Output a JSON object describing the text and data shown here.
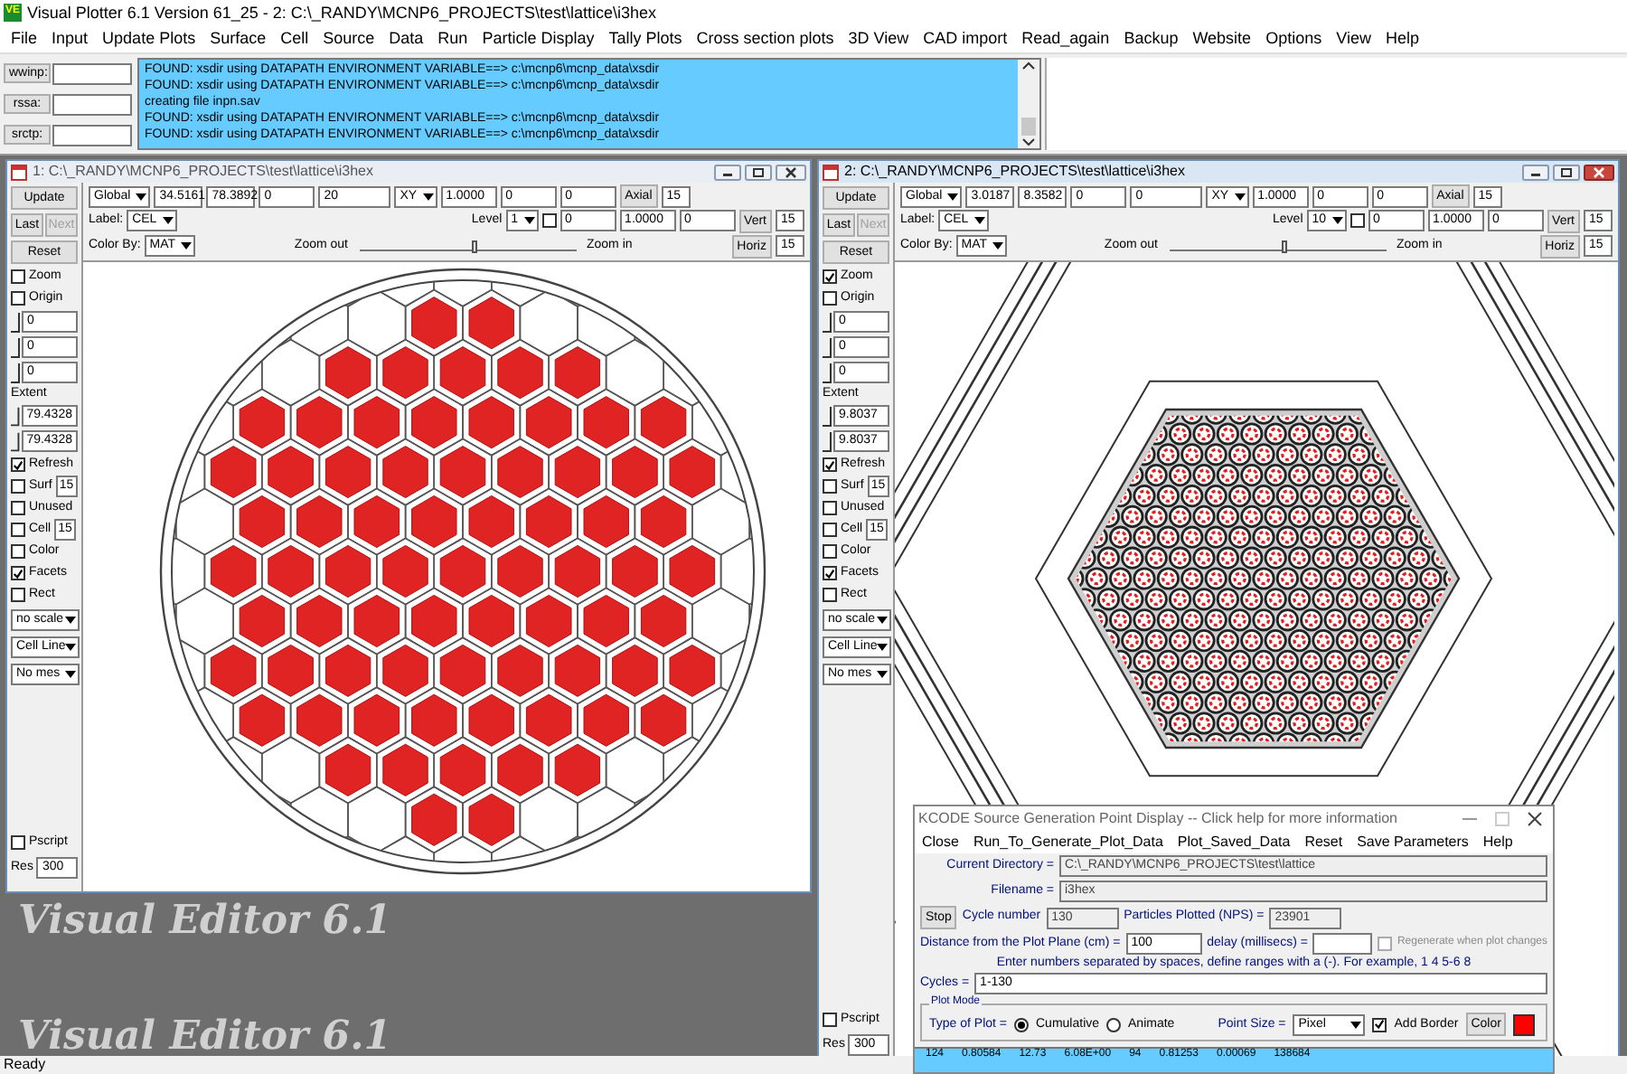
{
  "window": {
    "icon_text": "VE",
    "title": "Visual Plotter 6.1 Version 61_25  - 2:  C:\\_RANDY\\MCNP6_PROJECTS\\test\\lattice\\i3hex"
  },
  "menu": [
    "File",
    "Input",
    "Update Plots",
    "Surface",
    "Cell",
    "Source",
    "Data",
    "Run",
    "Particle Display",
    "Tally Plots",
    "Cross section plots",
    "3D View",
    "CAD import",
    "Read_again",
    "Backup",
    "Website",
    "Options",
    "View",
    "Help"
  ],
  "top_fields": [
    {
      "label": "wwinp:"
    },
    {
      "label": "rssa:"
    },
    {
      "label": "srctp:"
    }
  ],
  "messages": [
    "FOUND: xsdir  using DATAPATH ENVIRONMENT VARIABLE==>  c:\\mcnp6\\mcnp_data\\xsdir",
    "FOUND: xsdir  using DATAPATH ENVIRONMENT VARIABLE==>  c:\\mcnp6\\mcnp_data\\xsdir",
    "creating file inpn.sav",
    "FOUND: xsdir  using DATAPATH ENVIRONMENT VARIABLE==>  c:\\mcnp6\\mcnp_data\\xsdir",
    "FOUND: xsdir  using DATAPATH ENVIRONMENT VARIABLE==>  c:\\mcnp6\\mcnp_data\\xsdir"
  ],
  "background_text": [
    "Visual Editor 6.1",
    "Visual Editor 6.1"
  ],
  "plot_windows": [
    {
      "title": "1:  C:\\_RANDY\\MCNP6_PROJECTS\\test\\lattice\\i3hex",
      "active": false,
      "kind": "core",
      "toolbar": {
        "origin": "Global",
        "row1": [
          "34.5161",
          "78.3892",
          "0",
          "20"
        ],
        "plane": "XY",
        "row1b": [
          "1.0000",
          "0",
          "0"
        ],
        "label_caption": "Label:",
        "label": "CEL",
        "level_caption": "Level",
        "level_value": "1",
        "level_checked": false,
        "row2": [
          "0",
          "1.0000",
          "0"
        ],
        "color_by_caption": "Color By:",
        "color_by": "MAT",
        "zoom_out": "Zoom out",
        "zoom_in": "Zoom in",
        "zoom": {
          "level": 0.52
        },
        "axes": [
          {
            "label": "Axial",
            "value": "15"
          },
          {
            "label": "Vert",
            "value": "15"
          },
          {
            "label": "Horiz",
            "value": "15"
          }
        ]
      },
      "sidebar": [
        {
          "kind": "button",
          "label": "Update"
        },
        {
          "kind": "pair",
          "buttons": [
            {
              "label": "Last",
              "disabled": false
            },
            {
              "label": "Next",
              "disabled": true
            }
          ]
        },
        {
          "kind": "button",
          "label": "Reset"
        },
        {
          "kind": "check",
          "label": "Zoom",
          "checked": false
        },
        {
          "kind": "check",
          "label": "Origin",
          "checked": false
        },
        {
          "kind": "slider",
          "value": "0"
        },
        {
          "kind": "slider",
          "value": "0"
        },
        {
          "kind": "slider",
          "value": "0"
        },
        {
          "kind": "caption",
          "label": "Extent"
        },
        {
          "kind": "slider",
          "value": "79.4328"
        },
        {
          "kind": "slider",
          "value": "79.4328"
        },
        {
          "kind": "check",
          "label": "Refresh",
          "checked": true
        },
        {
          "kind": "check",
          "label": "Surf",
          "checked": false,
          "value": "15"
        },
        {
          "kind": "check",
          "label": "Unused",
          "checked": false
        },
        {
          "kind": "check",
          "label": "Cell",
          "checked": false,
          "value": "15"
        },
        {
          "kind": "check",
          "label": "Color",
          "checked": false
        },
        {
          "kind": "check",
          "label": "Facets",
          "checked": true
        },
        {
          "kind": "check",
          "label": "Rect",
          "checked": false
        },
        {
          "kind": "select",
          "value": "no scale"
        },
        {
          "kind": "select",
          "value": "Cell Line"
        },
        {
          "kind": "select",
          "value": "No mes"
        }
      ],
      "sidebar_bottom": [
        {
          "kind": "check",
          "label": "Pscript",
          "checked": false
        },
        {
          "kind": "field",
          "label": "Res",
          "value": "300"
        }
      ]
    },
    {
      "title": "2:  C:\\_RANDY\\MCNP6_PROJECTS\\test\\lattice\\i3hex",
      "active": true,
      "kind": "assembly",
      "toolbar": {
        "origin": "Global",
        "row1": [
          "3.0187",
          "8.3582",
          "0",
          "0"
        ],
        "plane": "XY",
        "row1b": [
          "1.0000",
          "0",
          "0"
        ],
        "label_caption": "Label:",
        "label": "CEL",
        "level_caption": "Level",
        "level_value": "10",
        "level_checked": false,
        "row2": [
          "0",
          "1.0000",
          "0"
        ],
        "color_by_caption": "Color By:",
        "color_by": "MAT",
        "zoom_out": "Zoom out",
        "zoom_in": "Zoom in",
        "zoom": {
          "level": 0.52
        },
        "axes": [
          {
            "label": "Axial",
            "value": "15"
          },
          {
            "label": "Vert",
            "value": "15"
          },
          {
            "label": "Horiz",
            "value": "15"
          }
        ]
      },
      "sidebar": [
        {
          "kind": "button",
          "label": "Update"
        },
        {
          "kind": "pair",
          "buttons": [
            {
              "label": "Last",
              "disabled": false
            },
            {
              "label": "Next",
              "disabled": true
            }
          ]
        },
        {
          "kind": "button",
          "label": "Reset"
        },
        {
          "kind": "check",
          "label": "Zoom",
          "checked": true
        },
        {
          "kind": "check",
          "label": "Origin",
          "checked": false
        },
        {
          "kind": "slider",
          "value": "0"
        },
        {
          "kind": "slider",
          "value": "0"
        },
        {
          "kind": "slider",
          "value": "0"
        },
        {
          "kind": "caption",
          "label": "Extent"
        },
        {
          "kind": "slider",
          "value": "9.8037"
        },
        {
          "kind": "slider",
          "value": "9.8037"
        },
        {
          "kind": "check",
          "label": "Refresh",
          "checked": true
        },
        {
          "kind": "check",
          "label": "Surf",
          "checked": false,
          "value": "15"
        },
        {
          "kind": "check",
          "label": "Unused",
          "checked": false
        },
        {
          "kind": "check",
          "label": "Cell",
          "checked": false,
          "value": "15"
        },
        {
          "kind": "check",
          "label": "Color",
          "checked": false
        },
        {
          "kind": "check",
          "label": "Facets",
          "checked": true
        },
        {
          "kind": "check",
          "label": "Rect",
          "checked": false
        },
        {
          "kind": "select",
          "value": "no scale"
        },
        {
          "kind": "select",
          "value": "Cell Line"
        },
        {
          "kind": "select",
          "value": "No mes"
        }
      ],
      "sidebar_bottom": [
        {
          "kind": "check",
          "label": "Pscript",
          "checked": false
        },
        {
          "kind": "field",
          "label": "Res",
          "value": "300"
        }
      ]
    }
  ],
  "kcode_dialog": {
    "title": "KCODE Source Generation Point Display -- Click help for more information",
    "menu": [
      "Close",
      "Run_To_Generate_Plot_Data",
      "Plot_Saved_Data",
      "Reset",
      "Save Parameters",
      "Help"
    ],
    "current_directory": {
      "label": "Current Directory =",
      "value": "C:\\_RANDY\\MCNP6_PROJECTS\\test\\lattice"
    },
    "filename": {
      "label": "Filename =",
      "value": "i3hex"
    },
    "stop": "Stop",
    "cycle": {
      "label": "Cycle number",
      "value": "130"
    },
    "nps": {
      "label": "Particles Plotted (NPS) =",
      "value": "23901"
    },
    "distance": {
      "label": "Distance from the Plot Plane (cm) =",
      "value": "100"
    },
    "delay": {
      "label": "delay (millisecs) ="
    },
    "regenerate": {
      "label": "Regenerate when plot changes",
      "checked": false,
      "disabled": true
    },
    "hint": "Enter numbers separated by spaces, define ranges with a (-).  For example, 1 4 5-6 8",
    "cycles": {
      "label": "Cycles =",
      "value": "1-130"
    },
    "plot_mode": {
      "legend": "Plot Mode",
      "type_label": "Type of Plot =",
      "options": [
        {
          "label": "Cumulative",
          "selected": true
        },
        {
          "label": "Animate",
          "selected": false
        }
      ]
    },
    "point_size": {
      "label": "Point Size =",
      "value": "Pixel"
    },
    "add_border": {
      "label": "Add Border",
      "checked": true
    },
    "color_button": "Color",
    "swatch": {
      "color": "#ff0000"
    },
    "output_rows": [
      [
        "124",
        "0.80584",
        "12.73",
        "6.08E+00",
        "94",
        "0.81253",
        "0.00069",
        "138684"
      ]
    ]
  },
  "status_bar": "Ready"
}
